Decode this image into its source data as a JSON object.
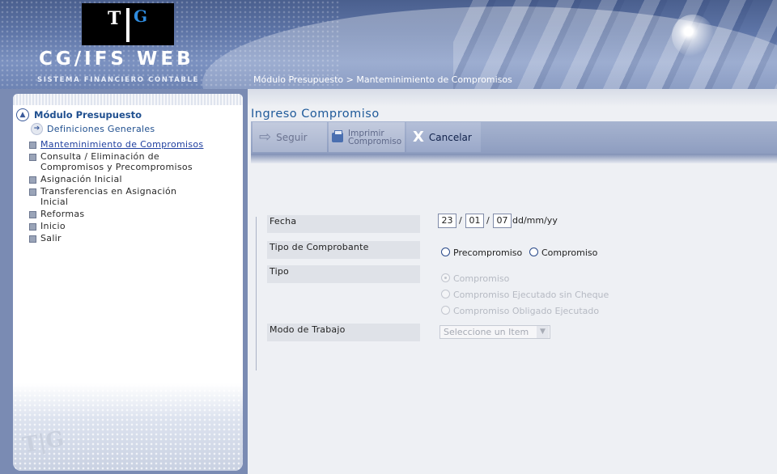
{
  "header": {
    "logo_t": "T",
    "logo_g": "G",
    "app_name": "CG/IFS WEB",
    "app_subtitle": "SISTEMA FINANCIERO CONTABLE",
    "breadcrumb": "Módulo Presupuesto > Manteminimiento de Compromisos"
  },
  "sidebar": {
    "section_title": "Módulo Presupuesto",
    "definitions": "Definiciones Generales",
    "items": [
      {
        "label": "Manteminimiento de Compromisos",
        "active": true
      },
      {
        "label": "Consulta / Eliminación de Compromisos y Precompromisos"
      },
      {
        "label": "Asignación Inicial"
      },
      {
        "label": "Transferencias en Asignación Inicial"
      },
      {
        "label": "Reformas"
      },
      {
        "label": "Inicio"
      },
      {
        "label": "Salir"
      }
    ],
    "footer_logo": "T|G"
  },
  "main": {
    "title": "Ingreso Compromiso",
    "toolbar": {
      "seguir": "Seguir",
      "imprimir_line1": "Imprimir",
      "imprimir_line2": "Compromiso",
      "cancelar": "Cancelar"
    },
    "form": {
      "fecha_label": "Fecha",
      "fecha_day": "23",
      "fecha_month": "01",
      "fecha_year": "07",
      "fecha_sep": "/",
      "fecha_format": "dd/mm/yy",
      "tipo_comprobante_label": "Tipo de Comprobante",
      "tipo_comprobante_options": [
        "Precompromiso",
        "Compromiso"
      ],
      "tipo_label": "Tipo",
      "tipo_options": [
        "Compromiso",
        "Compromiso Ejecutado sin Cheque",
        "Compromiso Obligado Ejecutado"
      ],
      "modo_label": "Modo de Trabajo",
      "modo_value": "Seleccione un Item"
    }
  },
  "colors": {
    "header_blue": "#5d74a6",
    "title_blue": "#1f5a9a",
    "toolbar_blue": "#9aa8c9"
  }
}
